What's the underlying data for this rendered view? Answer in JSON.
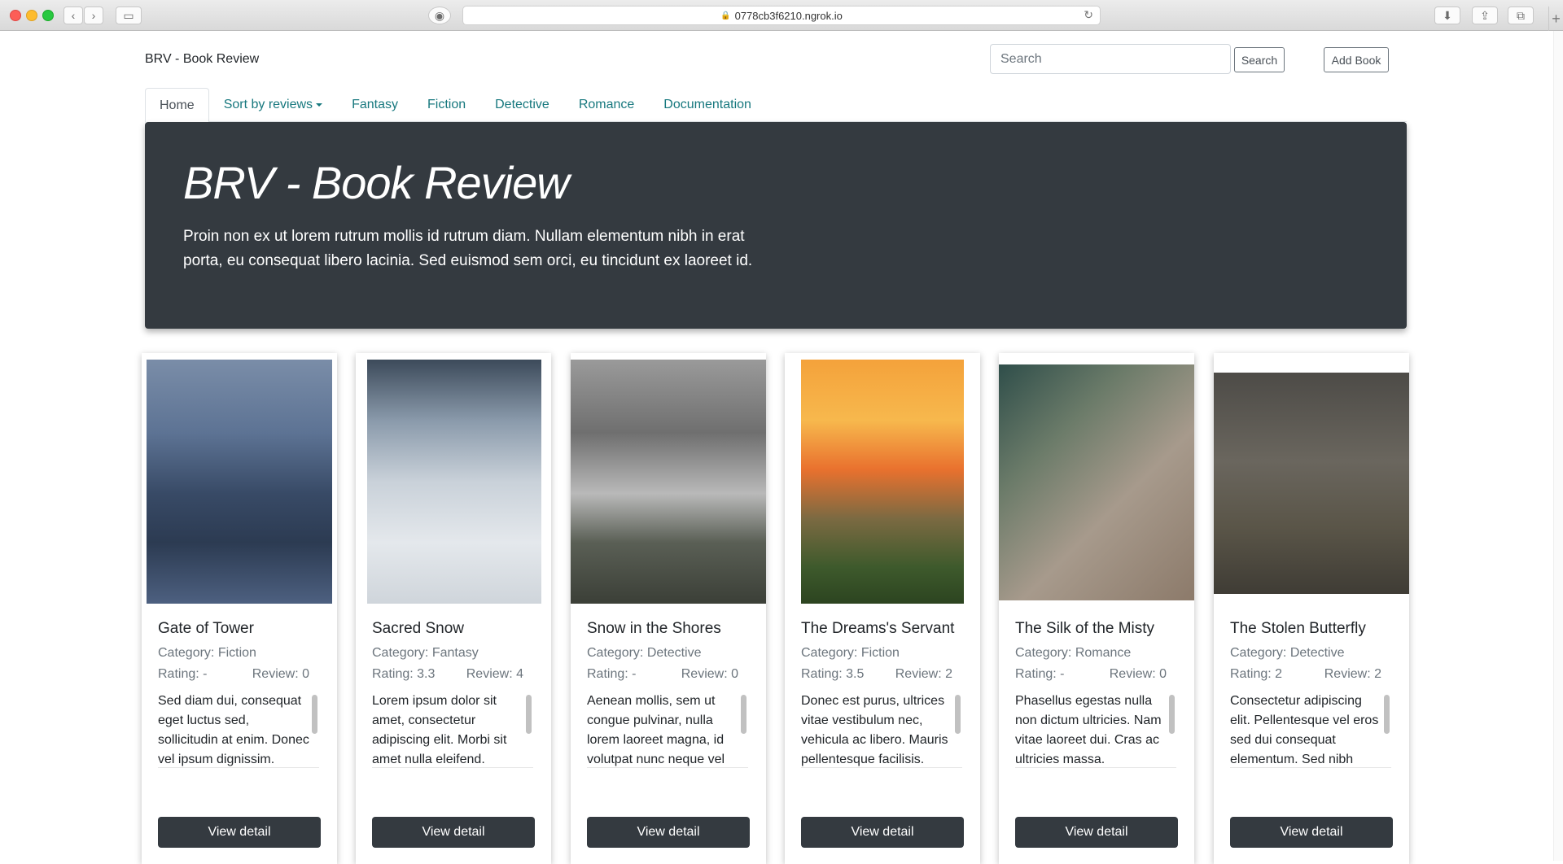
{
  "browser": {
    "url": "0778cb3f6210.ngrok.io"
  },
  "navbar": {
    "brand": "BRV - Book Review",
    "search_placeholder": "Search",
    "search_button": "Search",
    "add_button": "Add Book"
  },
  "tabs": [
    {
      "label": "Home",
      "active": true
    },
    {
      "label": "Sort by reviews",
      "dropdown": true
    },
    {
      "label": "Fantasy"
    },
    {
      "label": "Fiction"
    },
    {
      "label": "Detective"
    },
    {
      "label": "Romance"
    },
    {
      "label": "Documentation"
    }
  ],
  "jumbotron": {
    "title": "BRV - Book Review",
    "text": "Proin non ex ut lorem rutrum mollis id rutrum diam. Nullam elementum nibh in erat porta, eu consequat libero lacinia. Sed euismod sem orci, eu tincidunt ex laoreet id."
  },
  "books": [
    {
      "title": "Gate of Tower",
      "category": "Category: Fiction",
      "rating": "Rating: -",
      "review": "Review: 0",
      "description": "Sed diam dui, consequat eget luctus sed, sollicitudin at enim. Donec vel ipsum dignissim.",
      "button": "View detail"
    },
    {
      "title": "Sacred Snow",
      "category": "Category: Fantasy",
      "rating": "Rating: 3.3",
      "review": "Review: 4",
      "description": "Lorem ipsum dolor sit amet, consectetur adipiscing elit. Morbi sit amet nulla eleifend.",
      "button": "View detail"
    },
    {
      "title": "Snow in the Shores",
      "category": "Category: Detective",
      "rating": "Rating: -",
      "review": "Review: 0",
      "description": "Aenean mollis, sem ut congue pulvinar, nulla lorem laoreet magna, id volutpat nunc neque vel arcu.",
      "button": "View detail"
    },
    {
      "title": "The Dreams's Servant",
      "category": "Category: Fiction",
      "rating": "Rating: 3.5",
      "review": "Review: 2",
      "description": "Donec est purus, ultrices vitae vestibulum nec, vehicula ac libero. Mauris pellentesque facilisis.",
      "button": "View detail"
    },
    {
      "title": "The Silk of the Misty",
      "category": "Category: Romance",
      "rating": "Rating: -",
      "review": "Review: 0",
      "description": "Phasellus egestas nulla non dictum ultricies. Nam vitae laoreet dui. Cras ac ultricies massa.",
      "button": "View detail"
    },
    {
      "title": "The Stolen Butterfly",
      "category": "Category: Detective",
      "rating": "Rating: 2",
      "review": "Review: 2",
      "description": "Consectetur adipiscing elit. Pellentesque vel eros sed dui consequat elementum. Sed nibh arcu.",
      "button": "View detail"
    }
  ]
}
